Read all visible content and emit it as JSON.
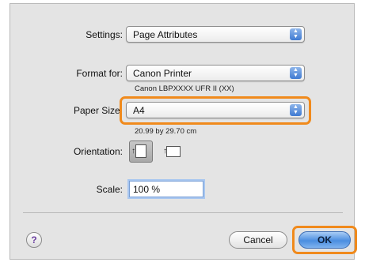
{
  "settings": {
    "label": "Settings:",
    "value": "Page Attributes"
  },
  "format_for": {
    "label": "Format for:",
    "value": "Canon Printer",
    "note": "Canon LBPXXXX UFR II (XX)"
  },
  "paper_size": {
    "label": "Paper Size:",
    "value": "A4",
    "note": "20.99 by 29.70 cm"
  },
  "orientation": {
    "label": "Orientation:",
    "selected": "portrait"
  },
  "scale": {
    "label": "Scale:",
    "value": "100 %"
  },
  "buttons": {
    "help": "?",
    "cancel": "Cancel",
    "ok": "OK"
  },
  "colors": {
    "highlight": "#f08a1c",
    "popup_arrow": "#3f7ad2",
    "default_button": "#4b8ee0"
  },
  "icons": {
    "popup_arrows": "up-down-arrows-icon",
    "portrait": "portrait-orientation-icon",
    "landscape": "landscape-orientation-icon"
  }
}
